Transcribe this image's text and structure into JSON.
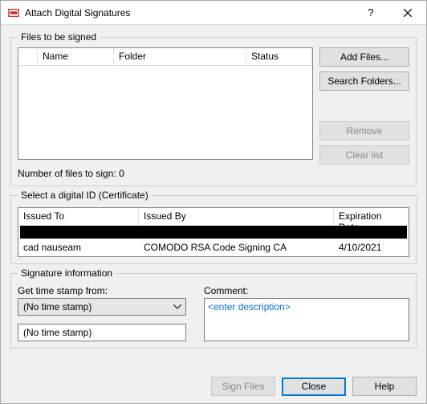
{
  "window": {
    "title": "Attach Digital Signatures"
  },
  "files_group": {
    "legend": "Files to be signed",
    "columns": {
      "name": "Name",
      "folder": "Folder",
      "status": "Status"
    },
    "buttons": {
      "add": "Add Files...",
      "search": "Search Folders...",
      "remove": "Remove",
      "clear": "Clear list"
    },
    "count_prefix": "Number of files to sign: ",
    "count_value": "0"
  },
  "cert_group": {
    "legend": "Select a digital ID (Certificate)",
    "columns": {
      "issued_to": "Issued To",
      "issued_by": "Issued By",
      "expiration": "Expiration Date"
    },
    "row": {
      "issued_to": "cad nauseam",
      "issued_by": "COMODO RSA Code Signing CA",
      "expiration": "4/10/2021"
    }
  },
  "sig_group": {
    "legend": "Signature information",
    "timestamp_label": "Get time stamp from:",
    "timestamp_value": "(No time stamp)",
    "timestamp_status": "(No time stamp)",
    "comment_label": "Comment:",
    "comment_placeholder": "<enter description>"
  },
  "footer": {
    "sign": "Sign Files",
    "close": "Close",
    "help": "Help"
  }
}
